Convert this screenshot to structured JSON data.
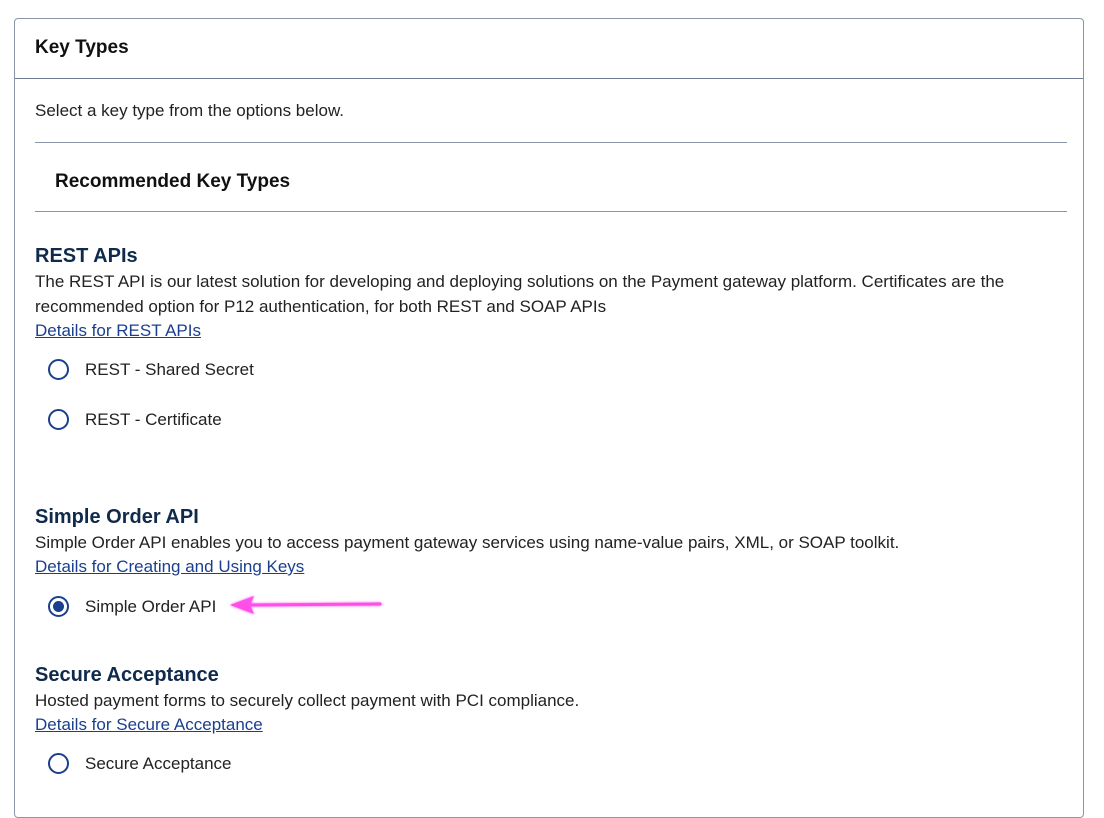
{
  "panel": {
    "title": "Key Types",
    "intro": "Select a key type from the options below.",
    "recommended_heading": "Recommended Key Types"
  },
  "sections": {
    "rest": {
      "title": "REST APIs",
      "description": "The REST API is our latest solution for developing and deploying solutions on the Payment gateway platform. Certificates are the recommended option for P12 authentication, for both REST and SOAP APIs",
      "link": "Details for REST APIs",
      "options": [
        {
          "label": "REST - Shared Secret",
          "selected": false
        },
        {
          "label": "REST - Certificate",
          "selected": false
        }
      ]
    },
    "simple_order": {
      "title": "Simple Order API",
      "description": "Simple Order API enables you to access payment gateway services using name-value pairs, XML, or SOAP toolkit.",
      "link": "Details for Creating and Using Keys",
      "options": [
        {
          "label": "Simple Order API",
          "selected": true
        }
      ]
    },
    "secure_acceptance": {
      "title": "Secure Acceptance",
      "description": "Hosted payment forms to securely collect payment with PCI compliance.",
      "link": "Details for Secure Acceptance",
      "options": [
        {
          "label": "Secure Acceptance",
          "selected": false
        }
      ]
    }
  },
  "colors": {
    "accent": "#1a3f8f",
    "section_title": "#0f2a4a",
    "annotation_arrow": "#ff4fe8"
  },
  "icons": {
    "radio_unselected": "radio-unselected-icon",
    "radio_selected": "radio-selected-icon",
    "annotation": "pointer-arrow-icon"
  }
}
